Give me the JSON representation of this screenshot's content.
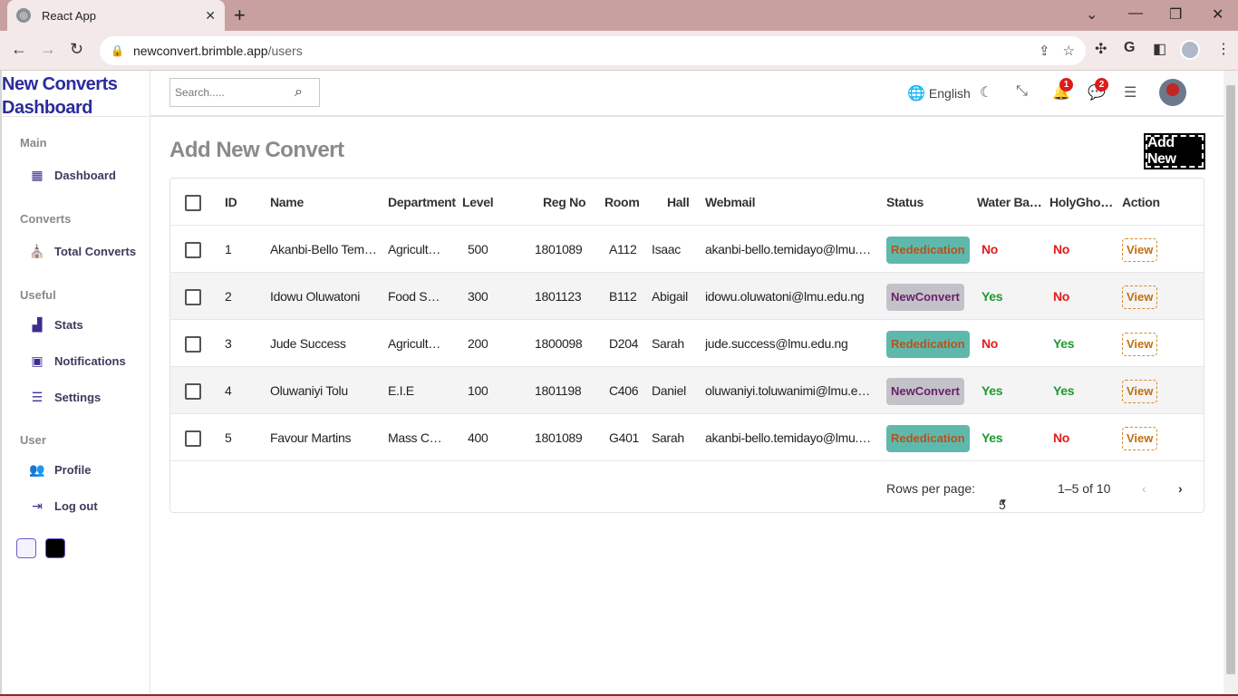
{
  "browser": {
    "tab_title": "React App",
    "url_host": "newconvert.brimble.app",
    "url_path": "/users"
  },
  "sidebar": {
    "brand_line1": "New Converts",
    "brand_line2": "Dashboard",
    "sections": {
      "main": "Main",
      "converts": "Converts",
      "useful": "Useful",
      "user": "User"
    },
    "items": {
      "dashboard": "Dashboard",
      "total_converts": "Total Converts",
      "stats": "Stats",
      "notifications": "Notifications",
      "settings": "Settings",
      "profile": "Profile",
      "logout": "Log out"
    },
    "theme_colors": [
      "#f4f2ff",
      "#000000"
    ]
  },
  "topbar": {
    "search_placeholder": "Search.....",
    "language": "English",
    "notifications_count": "1",
    "messages_count": "2"
  },
  "page": {
    "title": "Add New Convert",
    "add_button": "Add New"
  },
  "table": {
    "headers": {
      "id": "ID",
      "name": "Name",
      "department": "Department",
      "level": "Level",
      "regno": "Reg No",
      "room": "Room",
      "hall": "Hall",
      "webmail": "Webmail",
      "status": "Status",
      "water": "Water Bap…",
      "holyghost": "HolyGhost …",
      "action": "Action"
    },
    "rows": [
      {
        "id": "1",
        "name": "Akanbi-Bello Temi…",
        "department": "Agricultu…",
        "level": "500",
        "regno": "1801089",
        "room": "A112",
        "hall": "Isaac",
        "webmail": "akanbi-bello.temidayo@lmu.e…",
        "status": "Rededication",
        "water": "No",
        "holyghost": "No",
        "action": "View"
      },
      {
        "id": "2",
        "name": "Idowu Oluwatoni",
        "department": "Food Sci…",
        "level": "300",
        "regno": "1801123",
        "room": "B112",
        "hall": "Abigail",
        "webmail": "idowu.oluwatoni@lmu.edu.ng",
        "status": "NewConvert",
        "water": "Yes",
        "holyghost": "No",
        "action": "View"
      },
      {
        "id": "3",
        "name": "Jude Success",
        "department": "Agricultu…",
        "level": "200",
        "regno": "1800098",
        "room": "D204",
        "hall": "Sarah",
        "webmail": "jude.success@lmu.edu.ng",
        "status": "Rededication",
        "water": "No",
        "holyghost": "Yes",
        "action": "View"
      },
      {
        "id": "4",
        "name": "Oluwaniyi Tolu",
        "department": "E.I.E",
        "level": "100",
        "regno": "1801198",
        "room": "C406",
        "hall": "Daniel",
        "webmail": "oluwaniyi.toluwanimi@lmu.ed…",
        "status": "NewConvert",
        "water": "Yes",
        "holyghost": "Yes",
        "action": "View"
      },
      {
        "id": "5",
        "name": "Favour Martins",
        "department": "Mass Co…",
        "level": "400",
        "regno": "1801089",
        "room": "G401",
        "hall": "Sarah",
        "webmail": "akanbi-bello.temidayo@lmu.e…",
        "status": "Rededication",
        "water": "Yes",
        "holyghost": "No",
        "action": "View"
      }
    ],
    "footer": {
      "rows_per_page_label": "Rows per page:",
      "rows_per_page_value": "5",
      "range": "1–5 of 10"
    }
  }
}
